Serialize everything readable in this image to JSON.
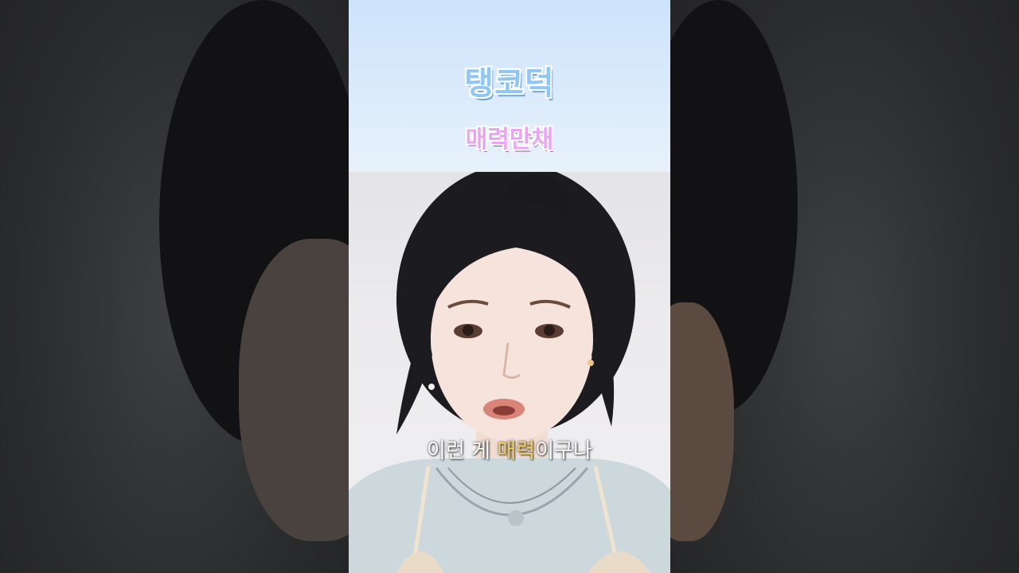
{
  "header": {
    "logo_text": "탱코덕",
    "tag_text": "매력만채"
  },
  "caption": {
    "before": "이런 게 ",
    "highlight": "매력",
    "after": "이구나"
  },
  "colors": {
    "header_bg": "#cde3fb",
    "logo": "#8fc6f3",
    "tag": "#e9a5ef",
    "caption_highlight": "#f5d36a"
  }
}
